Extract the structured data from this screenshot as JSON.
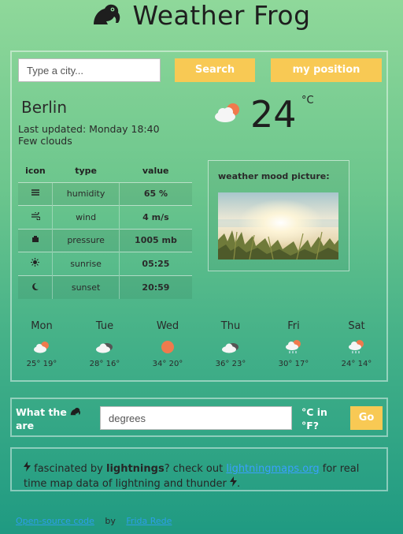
{
  "app": {
    "title": "Weather Frog"
  },
  "search": {
    "placeholder": "Type a city...",
    "search_label": "Search",
    "position_label": "my position"
  },
  "current": {
    "city": "Berlin",
    "updated": "Last updated: Monday 18:40",
    "description": "Few clouds",
    "temperature": "24",
    "unit": "°C",
    "icon": "cloud-sun-icon"
  },
  "details": {
    "headers": [
      "icon",
      "type",
      "value"
    ],
    "rows": [
      {
        "icon": "humidity-icon",
        "type": "humidity",
        "value": "65 %"
      },
      {
        "icon": "wind-icon",
        "type": "wind",
        "value": "4 m/s"
      },
      {
        "icon": "pressure-icon",
        "type": "pressure",
        "value": "1005 mb"
      },
      {
        "icon": "sunrise-icon",
        "type": "sunrise",
        "value": "05:25"
      },
      {
        "icon": "sunset-icon",
        "type": "sunset",
        "value": "20:59"
      }
    ]
  },
  "mood": {
    "label": "weather mood picture:"
  },
  "forecast": [
    {
      "day": "Mon",
      "temps": "25° 19°",
      "icon": "cloud-sun-icon"
    },
    {
      "day": "Tue",
      "temps": "28° 16°",
      "icon": "cloud-icon"
    },
    {
      "day": "Wed",
      "temps": "34° 20°",
      "icon": "sun-icon"
    },
    {
      "day": "Thu",
      "temps": "36° 23°",
      "icon": "cloud-icon"
    },
    {
      "day": "Fri",
      "temps": "30° 17°",
      "icon": "rain-sun-icon"
    },
    {
      "day": "Sat",
      "temps": "24° 14°",
      "icon": "rain-sun-icon"
    }
  ],
  "converter": {
    "label_start": "What the",
    "label_end": "are",
    "placeholder": "degrees",
    "unit_label": "°C in °F?",
    "go_label": "Go"
  },
  "info": {
    "part1": " fascinated by ",
    "bold": "lightnings",
    "part2": "? check out ",
    "link": "lightningmaps.org",
    "part3": " for real time map data of lightning and thunder ",
    "part4": "."
  },
  "footer": {
    "link1": "Open-source code",
    "by": "by",
    "link2": "Frida Rede"
  },
  "colors": {
    "accent": "#f8c954",
    "link": "#3aa0ff"
  }
}
